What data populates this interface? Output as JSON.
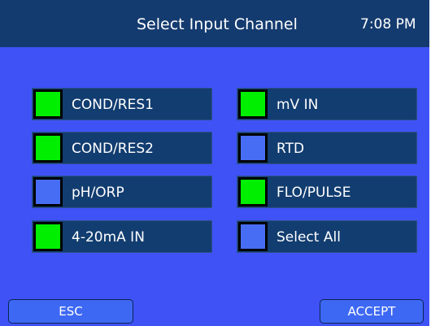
{
  "header": {
    "title": "Select Input Channel",
    "time": "7:08 PM"
  },
  "channels": [
    {
      "label": "COND/RES1",
      "selected": true
    },
    {
      "label": "mV IN",
      "selected": true
    },
    {
      "label": "COND/RES2",
      "selected": true
    },
    {
      "label": "RTD",
      "selected": false
    },
    {
      "label": "pH/ORP",
      "selected": false
    },
    {
      "label": "FLO/PULSE",
      "selected": true
    },
    {
      "label": "4-20mA IN",
      "selected": true
    },
    {
      "label": "Select All",
      "selected": false
    }
  ],
  "footer": {
    "esc_label": "ESC",
    "accept_label": "ACCEPT"
  },
  "colors": {
    "selected": "#00ef00",
    "unselected": "#476df4",
    "panel": "#3f52f6",
    "header": "#143b6f"
  }
}
